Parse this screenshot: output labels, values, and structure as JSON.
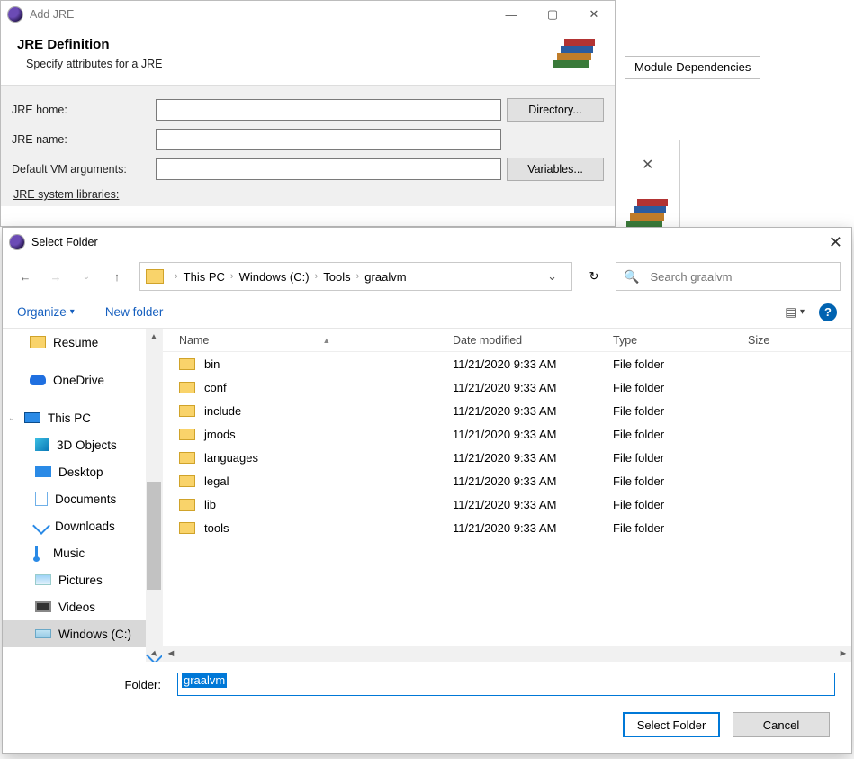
{
  "bg": {
    "tab_module_deps": "Module Dependencies"
  },
  "addjre": {
    "window_title": "Add JRE",
    "heading": "JRE Definition",
    "subtitle": "Specify attributes for a JRE",
    "labels": {
      "jre_home": "JRE home:",
      "jre_name": "JRE name:",
      "vm_args": "Default VM arguments:",
      "sys_libs": "JRE system libraries:"
    },
    "values": {
      "jre_home": "",
      "jre_name": "",
      "vm_args": ""
    },
    "buttons": {
      "directory": "Directory...",
      "variables": "Variables..."
    }
  },
  "folder": {
    "window_title": "Select Folder",
    "breadcrumb": [
      "This PC",
      "Windows (C:)",
      "Tools",
      "graalvm"
    ],
    "search_placeholder": "Search graalvm",
    "toolbar": {
      "organize": "Organize",
      "new_folder": "New folder"
    },
    "tree": [
      {
        "label": "Resume",
        "icon": "folder"
      },
      {
        "label": "OneDrive",
        "icon": "cloud",
        "spaced": true
      },
      {
        "label": "This PC",
        "icon": "pc",
        "expanded": true,
        "spaced": true
      },
      {
        "label": "3D Objects",
        "icon": "cube",
        "depth": 2
      },
      {
        "label": "Desktop",
        "icon": "desktop",
        "depth": 2
      },
      {
        "label": "Documents",
        "icon": "doc",
        "depth": 2
      },
      {
        "label": "Downloads",
        "icon": "down",
        "depth": 2
      },
      {
        "label": "Music",
        "icon": "music",
        "depth": 2
      },
      {
        "label": "Pictures",
        "icon": "pic",
        "depth": 2
      },
      {
        "label": "Videos",
        "icon": "film",
        "depth": 2
      },
      {
        "label": "Windows (C:)",
        "icon": "drive",
        "depth": 2,
        "selected": true
      }
    ],
    "columns": {
      "name": "Name",
      "date": "Date modified",
      "type": "Type",
      "size": "Size"
    },
    "rows": [
      {
        "name": "bin",
        "date": "11/21/2020 9:33 AM",
        "type": "File folder"
      },
      {
        "name": "conf",
        "date": "11/21/2020 9:33 AM",
        "type": "File folder"
      },
      {
        "name": "include",
        "date": "11/21/2020 9:33 AM",
        "type": "File folder"
      },
      {
        "name": "jmods",
        "date": "11/21/2020 9:33 AM",
        "type": "File folder"
      },
      {
        "name": "languages",
        "date": "11/21/2020 9:33 AM",
        "type": "File folder"
      },
      {
        "name": "legal",
        "date": "11/21/2020 9:33 AM",
        "type": "File folder"
      },
      {
        "name": "lib",
        "date": "11/21/2020 9:33 AM",
        "type": "File folder"
      },
      {
        "name": "tools",
        "date": "11/21/2020 9:33 AM",
        "type": "File folder"
      }
    ],
    "folder_label": "Folder:",
    "folder_value": "graalvm",
    "buttons": {
      "select": "Select Folder",
      "cancel": "Cancel"
    }
  }
}
